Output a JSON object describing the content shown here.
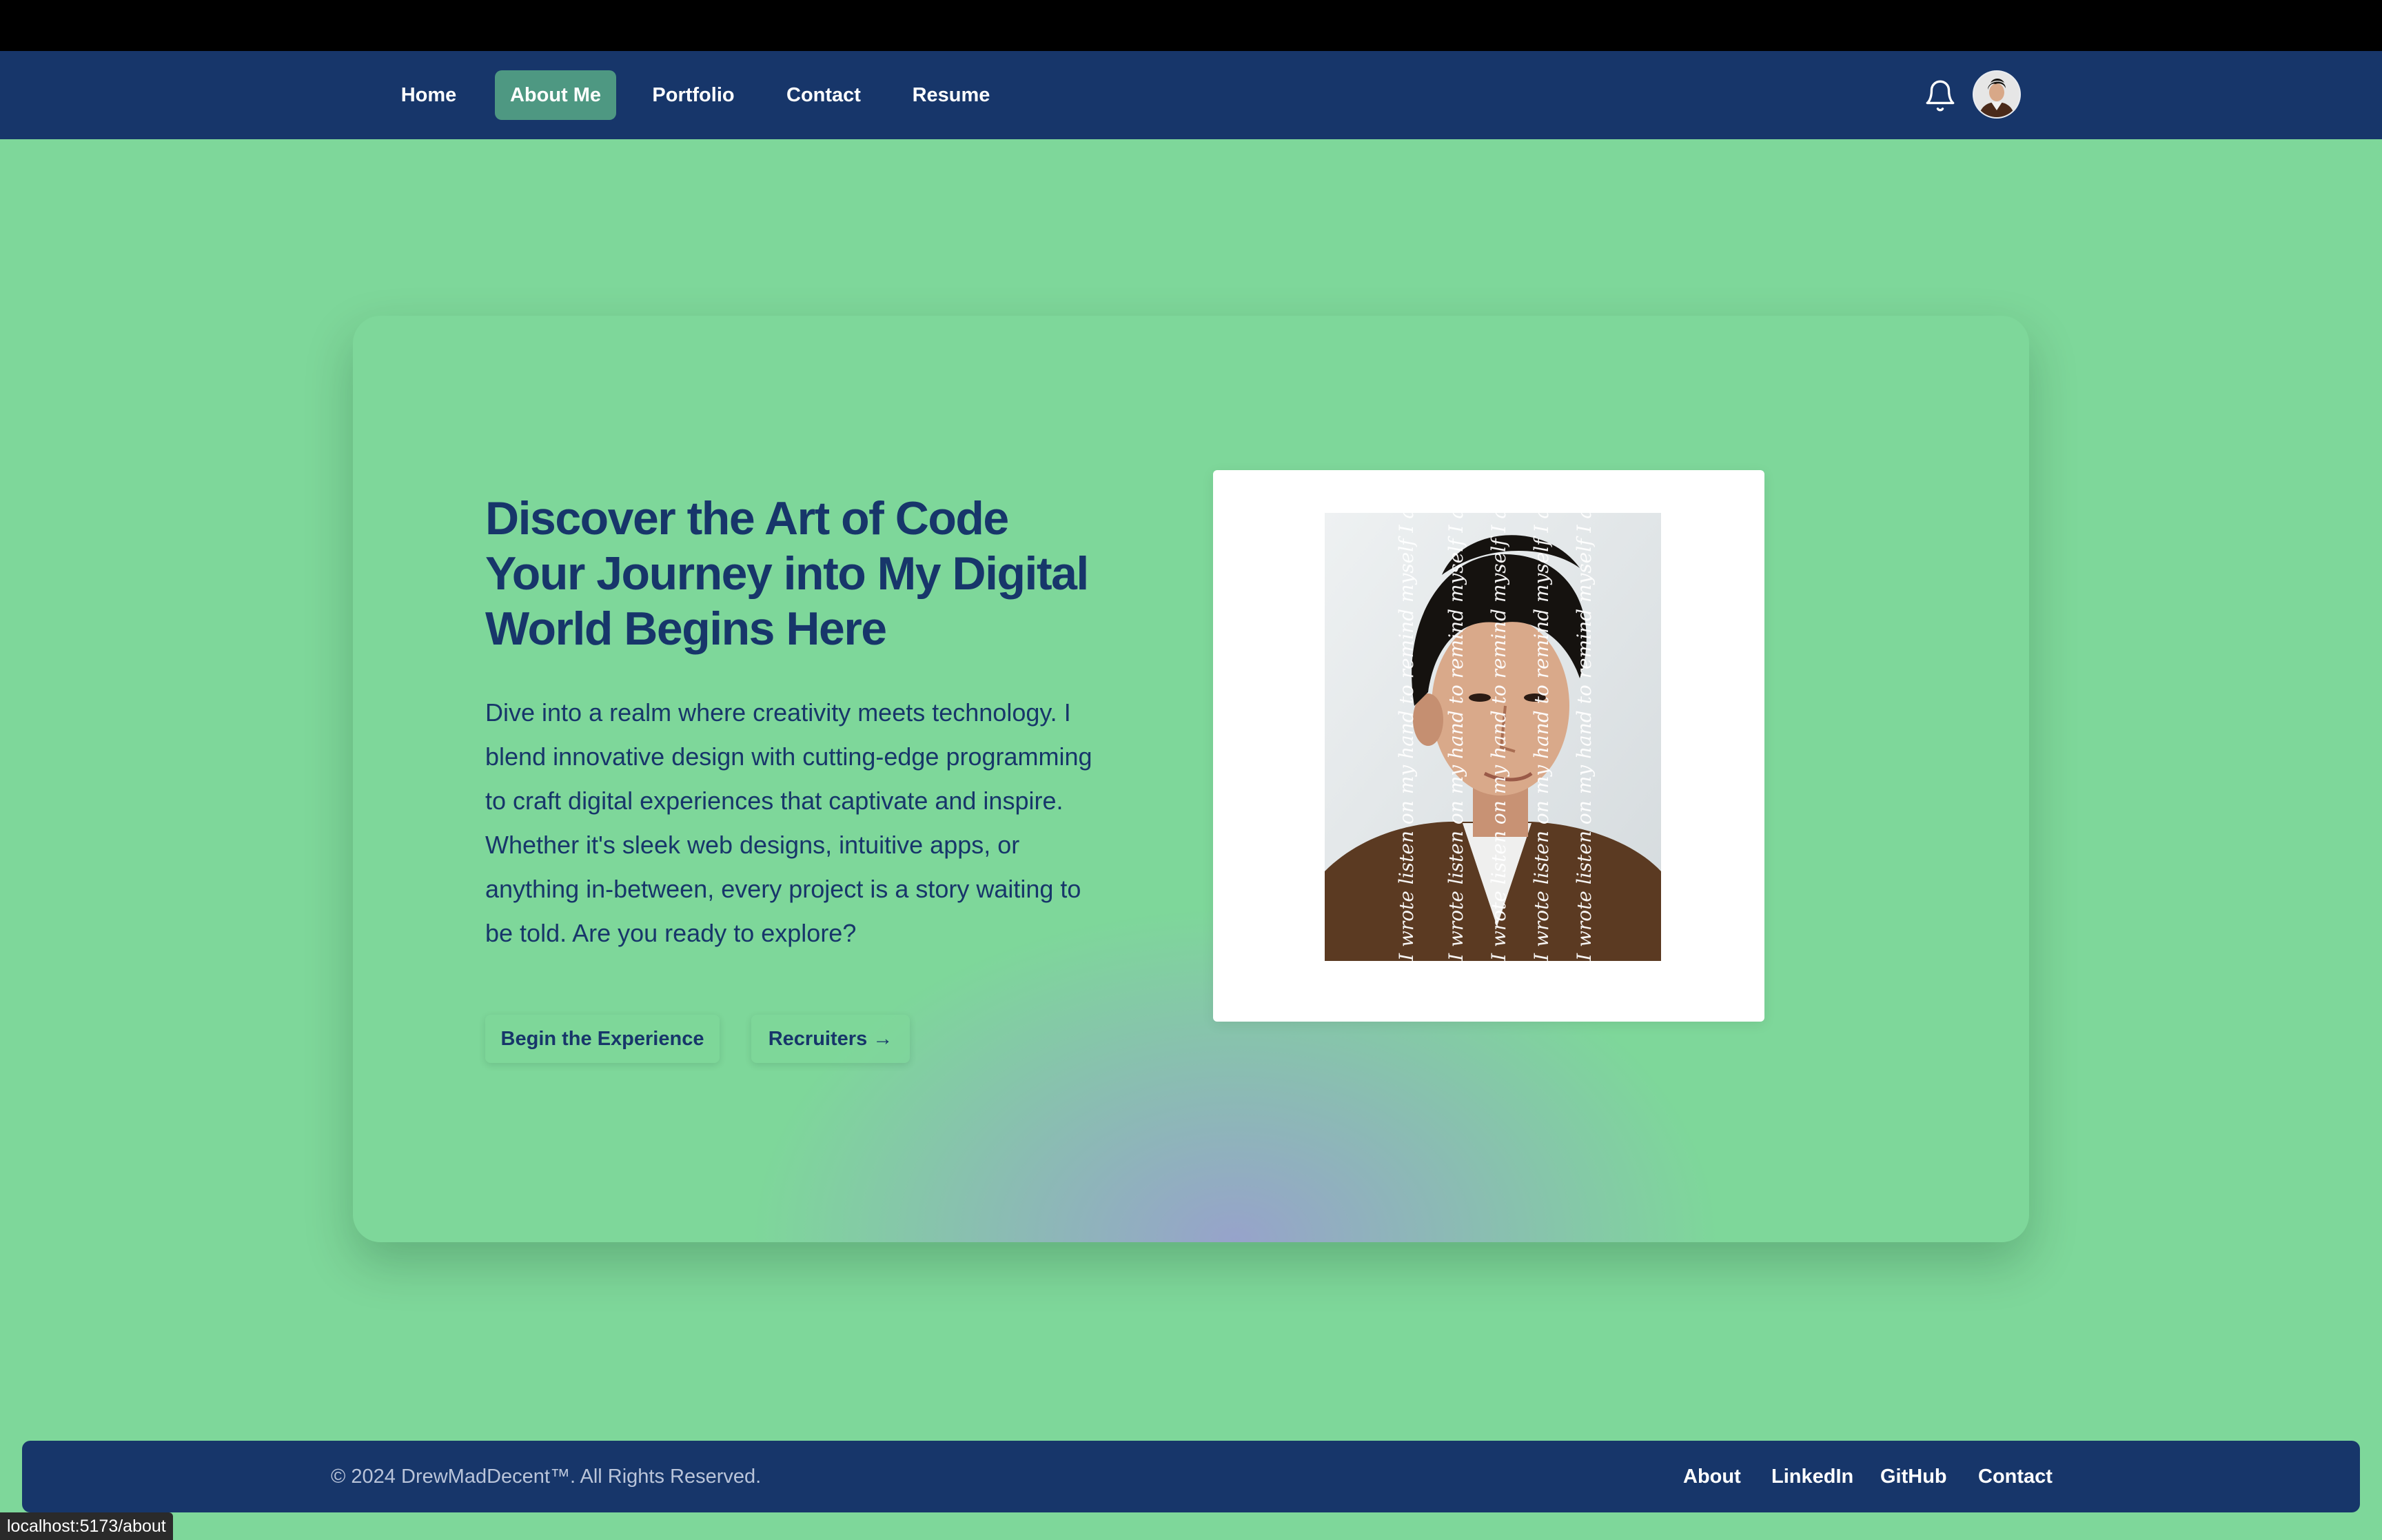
{
  "nav": {
    "items": [
      {
        "label": "Home"
      },
      {
        "label": "About Me"
      },
      {
        "label": "Portfolio"
      },
      {
        "label": "Contact"
      },
      {
        "label": "Resume"
      }
    ],
    "active_label": "About Me",
    "icons": {
      "notifications": "bell-icon",
      "profile": "avatar"
    }
  },
  "hero": {
    "title_line1": "Discover the Art of Code",
    "title_line2": "Your Journey into My Digital",
    "title_line3_bold": "World",
    "title_line3_rest": " Begins Here",
    "description": "Dive into a realm where creativity meets technology. I blend innovative design with cutting-edge programming to craft digital experiences that captivate and inspire. Whether it's sleek web designs, intuitive apps, or anything in-between, every project is a story waiting to be told. Are you ready to explore?",
    "buttons": {
      "primary": "Begin the Experience",
      "secondary": "Recruiters →"
    }
  },
  "portrait": {
    "overlay_text": "I wrote listen on my hand to remind myself I am a writer"
  },
  "footer": {
    "copyright": "© 2024 DrewMadDecent™. All Rights Reserved.",
    "links": [
      {
        "label": "About"
      },
      {
        "label": "LinkedIn"
      },
      {
        "label": "GitHub"
      },
      {
        "label": "Contact"
      }
    ]
  },
  "status_bar": {
    "url": "localhost:5173/about"
  },
  "colors": {
    "background": "#7ed79a",
    "navy": "#17366a",
    "active_tab": "#4e9882",
    "top_bar": "#000000",
    "white": "#ffffff"
  }
}
